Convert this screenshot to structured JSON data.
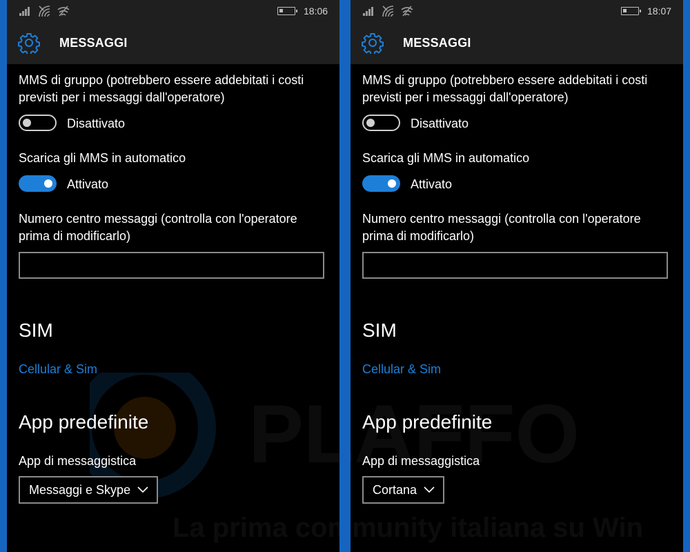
{
  "screens": [
    {
      "status": {
        "time": "18:06"
      },
      "header": {
        "title": "MESSAGGI"
      },
      "group_mms": {
        "label": "MMS di gruppo (potrebbero essere addebitati i costi previsti per i messaggi dall'operatore)",
        "toggle_state": "off",
        "toggle_text": "Disattivato"
      },
      "auto_mms": {
        "label": "Scarica gli MMS in automatico",
        "toggle_state": "on",
        "toggle_text": "Attivato"
      },
      "message_center": {
        "label": "Numero centro messaggi (controlla con l'operatore prima di modificarlo)",
        "value": ""
      },
      "sim": {
        "heading": "SIM",
        "link": "Cellular & Sim"
      },
      "default_apps": {
        "heading": "App predefinite",
        "messaging_label": "App di messaggistica",
        "messaging_value": "Messaggi e Skype"
      }
    },
    {
      "status": {
        "time": "18:07"
      },
      "header": {
        "title": "MESSAGGI"
      },
      "group_mms": {
        "label": "MMS di gruppo (potrebbero essere addebitati i costi previsti per i messaggi dall'operatore)",
        "toggle_state": "off",
        "toggle_text": "Disattivato"
      },
      "auto_mms": {
        "label": "Scarica gli MMS in automatico",
        "toggle_state": "on",
        "toggle_text": "Attivato"
      },
      "message_center": {
        "label": "Numero centro messaggi (controlla con l'operatore prima di modificarlo)",
        "value": ""
      },
      "sim": {
        "heading": "SIM",
        "link": "Cellular & Sim"
      },
      "default_apps": {
        "heading": "App predefinite",
        "messaging_label": "App di messaggistica",
        "messaging_value": "Cortana"
      }
    }
  ],
  "watermark": {
    "brand": "PLAFFO",
    "tagline": "La prima community italiana su Windows Phone"
  },
  "colors": {
    "accent": "#1e7fd8",
    "frame": "#1565c0",
    "header_bg": "#1f1f1f",
    "background": "#000000",
    "watermark_accent": "#e07b00"
  },
  "icons": [
    "signal-icon",
    "wifi-icon",
    "wifi-off-icon",
    "battery-icon",
    "gear-icon",
    "chevron-down-icon"
  ]
}
